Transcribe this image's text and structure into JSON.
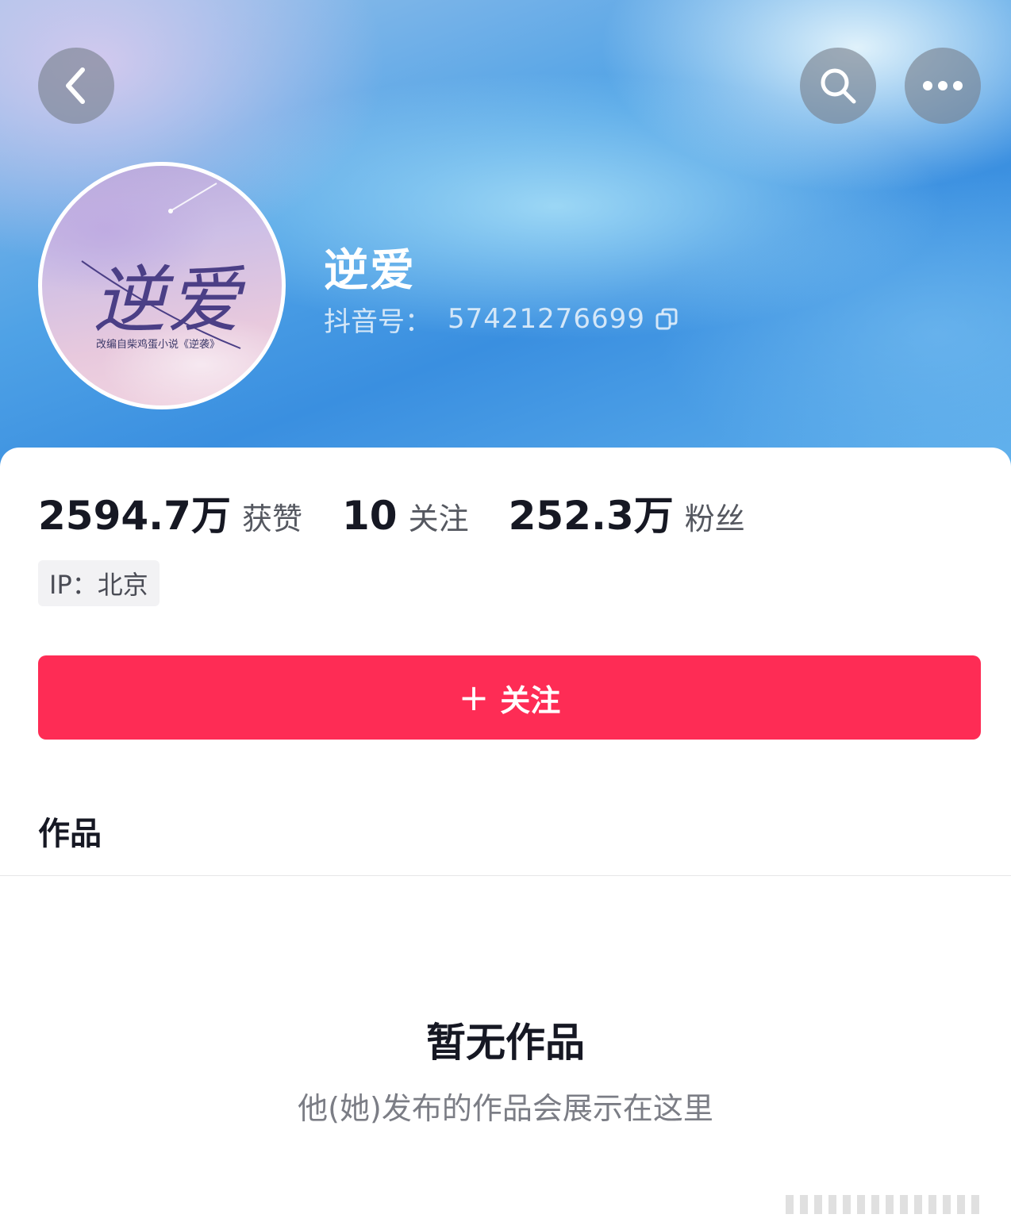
{
  "header": {
    "back_icon": "chevron-left-icon",
    "search_icon": "search-icon",
    "more_icon": "more-horizontal-icon"
  },
  "profile": {
    "avatar_title": "逆爱",
    "avatar_subtitle": "改编自柴鸡蛋小说《逆袭》",
    "name": "逆爱",
    "account_label": "抖音号：",
    "account_id": "57421276699",
    "copy_icon": "copy-icon"
  },
  "stats": [
    {
      "value": "2594.7万",
      "label": "获赞"
    },
    {
      "value": "10",
      "label": "关注"
    },
    {
      "value": "252.3万",
      "label": "粉丝"
    }
  ],
  "ip_tag": "IP：北京",
  "follow_button": {
    "plus": "+",
    "label": "关注"
  },
  "tabs": {
    "works": "作品"
  },
  "empty_state": {
    "title": "暂无作品",
    "description": "他(她)发布的作品会展示在这里"
  },
  "colors": {
    "accent": "#fe2c55",
    "text_primary": "#161823",
    "banner_blue": "#3a8fe0"
  }
}
